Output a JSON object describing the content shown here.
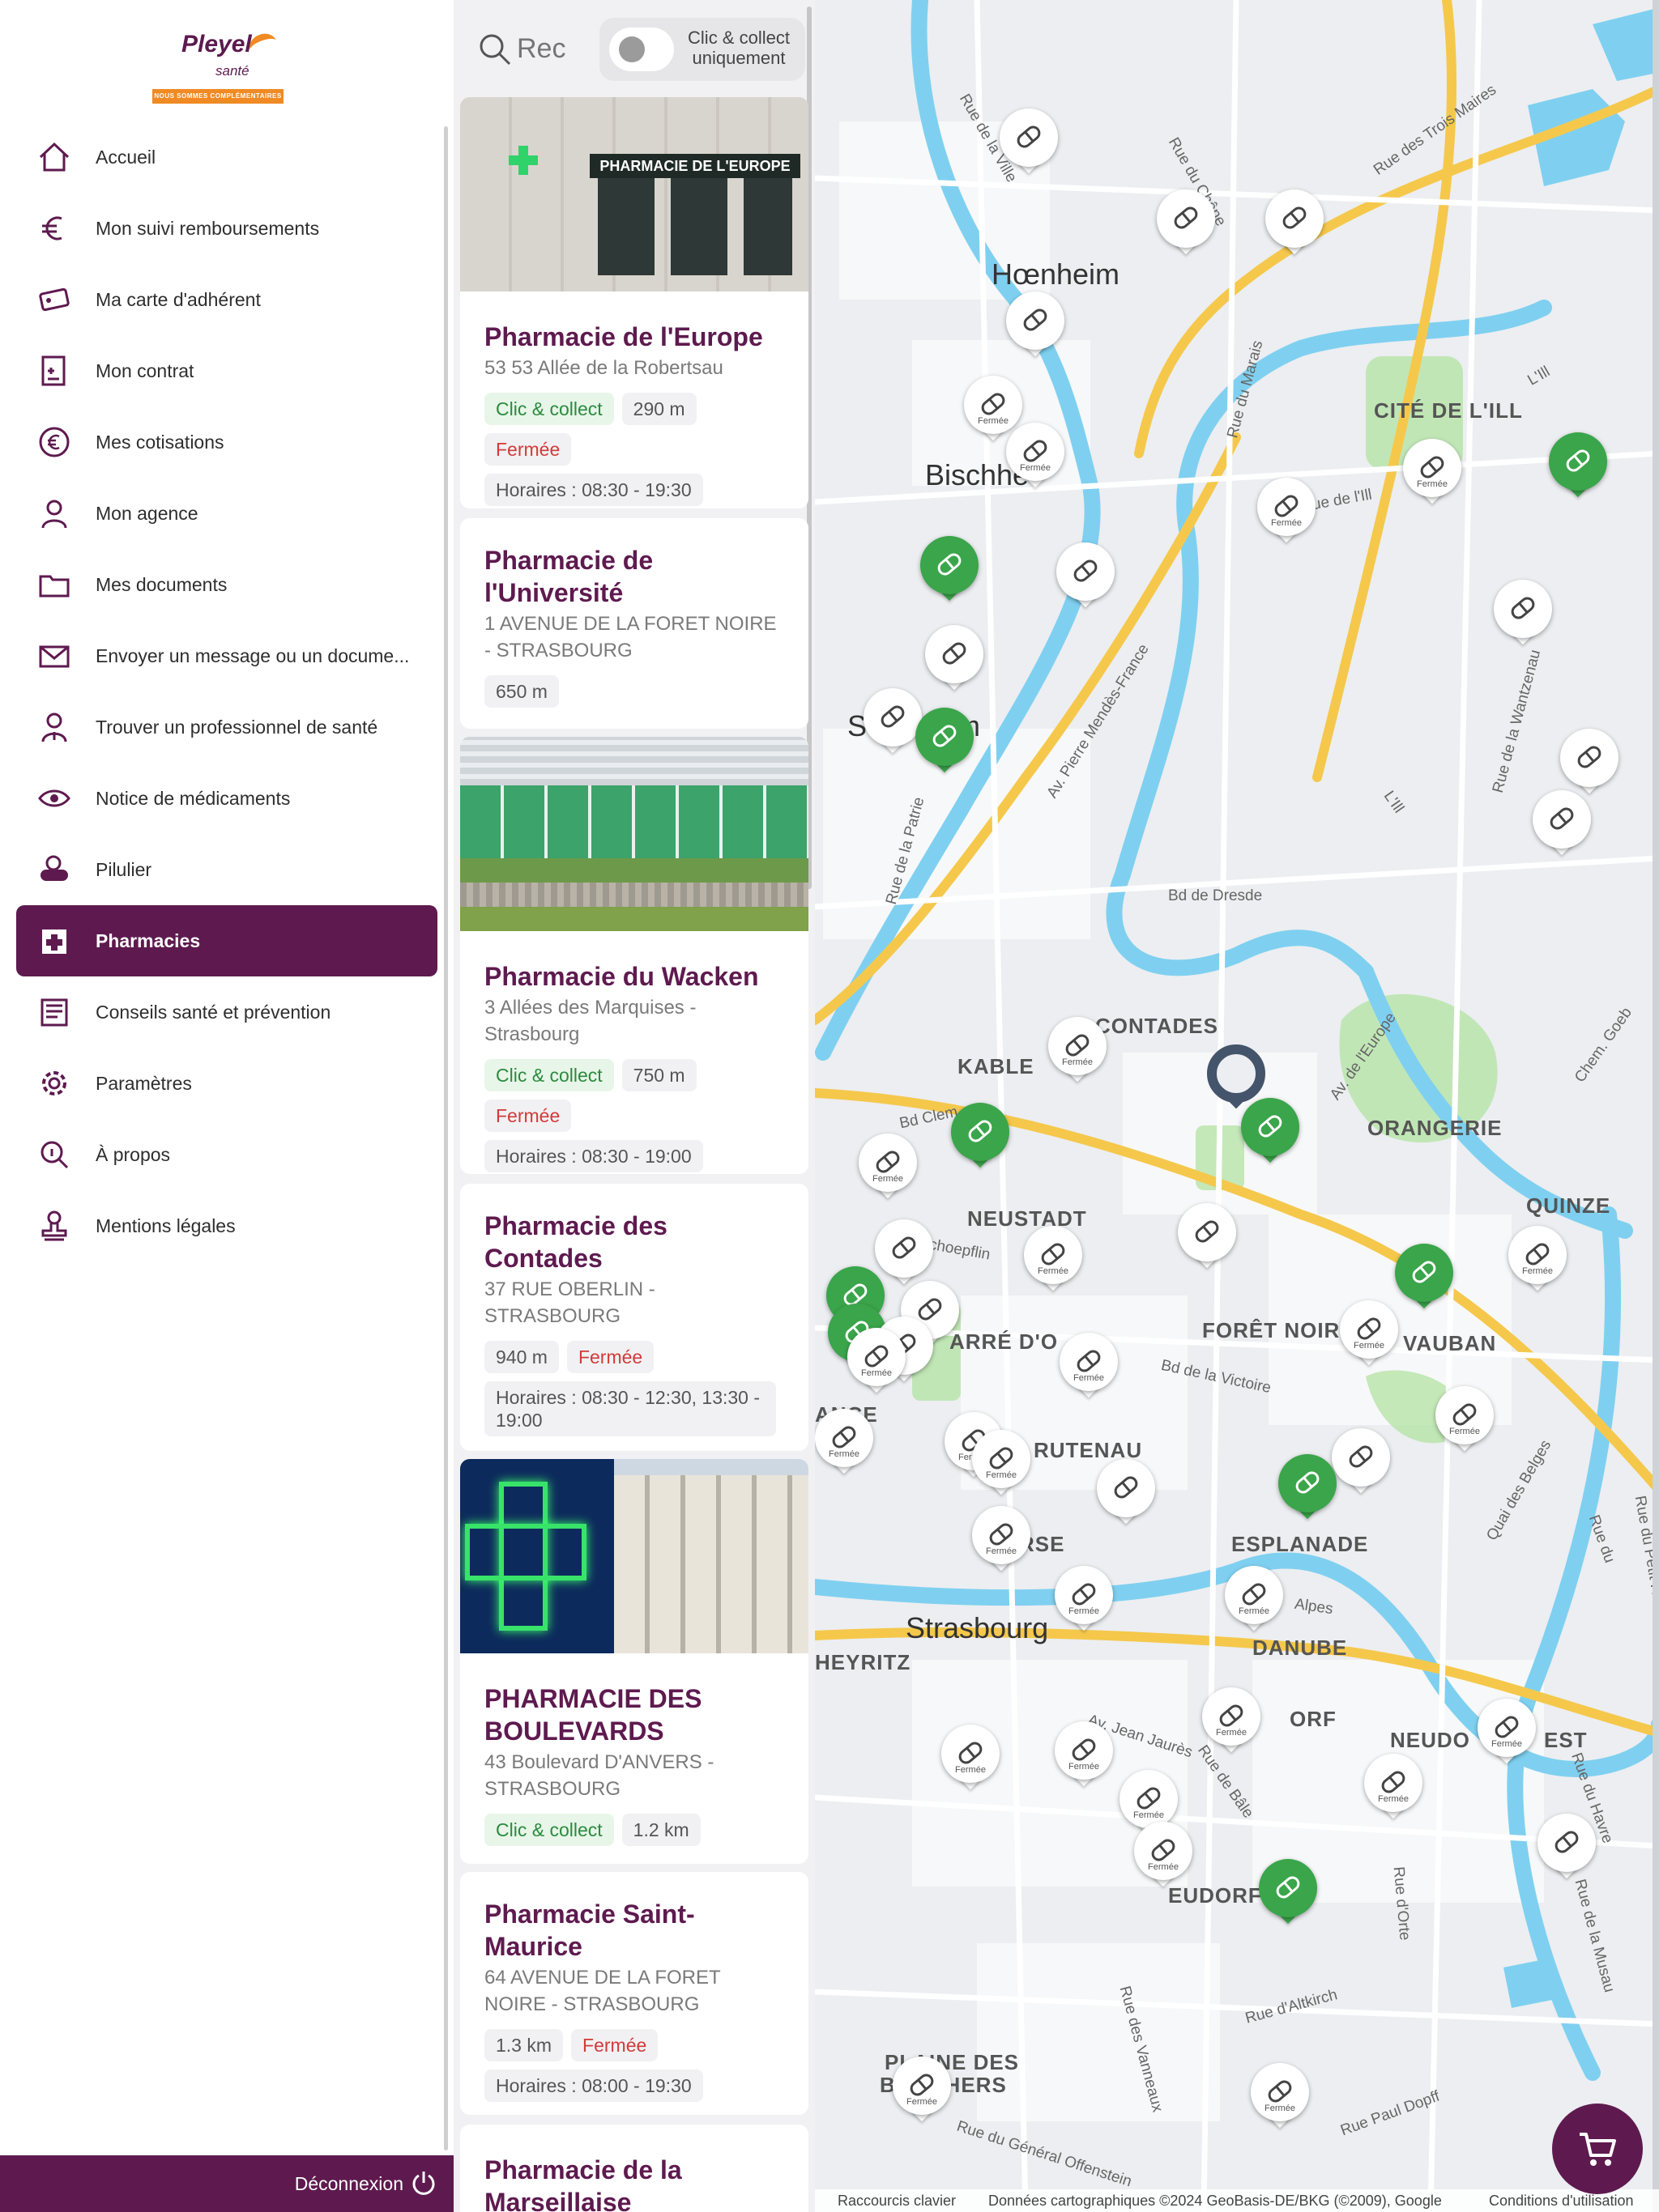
{
  "logo": {
    "brand": "Pleyel",
    "sub": "santé",
    "tagline": "NOUS SOMMES COMPLÉMENTAIRES"
  },
  "menu": [
    {
      "label": "Accueil",
      "icon": "home-icon"
    },
    {
      "label": "Mon suivi remboursements",
      "icon": "euro-icon"
    },
    {
      "label": "Ma carte d'adhérent",
      "icon": "card-icon"
    },
    {
      "label": "Mon contrat",
      "icon": "contract-icon"
    },
    {
      "label": "Mes cotisations",
      "icon": "euro-circle-icon"
    },
    {
      "label": "Mon agence",
      "icon": "agent-icon"
    },
    {
      "label": "Mes documents",
      "icon": "folder-icon"
    },
    {
      "label": "Envoyer un message ou un docume...",
      "icon": "envelope-icon"
    },
    {
      "label": "Trouver un professionnel de santé",
      "icon": "doctor-icon"
    },
    {
      "label": "Notice de médicaments",
      "icon": "eye-pill-icon"
    },
    {
      "label": "Pilulier",
      "icon": "pill-box-icon"
    },
    {
      "label": "Pharmacies",
      "icon": "pharmacy-icon",
      "active": true
    },
    {
      "label": "Conseils santé et prévention",
      "icon": "newspaper-icon"
    },
    {
      "label": "Paramètres",
      "icon": "gear-icon"
    },
    {
      "label": "À propos",
      "icon": "info-search-icon"
    },
    {
      "label": "Mentions légales",
      "icon": "stamp-icon"
    }
  ],
  "logout": {
    "label": "Déconnexion"
  },
  "search": {
    "placeholder": "Rechercher",
    "value": ""
  },
  "toggle": {
    "label": "Clic & collect uniquement",
    "on": false
  },
  "pharmacies": [
    {
      "name": "Pharmacie de l'Europe",
      "address": "53 53 Allée de la Robertsau",
      "clic_collect": "Clic & collect",
      "distance": "290 m",
      "status": "Fermée",
      "hours": "Horaires : 08:30 - 19:30",
      "photo_sign": "PHARMACIE DE L'EUROPE"
    },
    {
      "name": "Pharmacie de l'Université",
      "address": "1 AVENUE DE LA FORET NOIRE - STRASBOURG",
      "distance": "650 m"
    },
    {
      "name": "Pharmacie du Wacken",
      "address": "3 Allées des Marquises - Strasbourg",
      "clic_collect": "Clic & collect",
      "distance": "750 m",
      "status": "Fermée",
      "hours": "Horaires : 08:30 - 19:00"
    },
    {
      "name": "Pharmacie des Contades",
      "address": "37 RUE OBERLIN - STRASBOURG",
      "distance": "940 m",
      "status": "Fermée",
      "hours": "Horaires : 08:30 - 12:30, 13:30 - 19:00"
    },
    {
      "name": "PHARMACIE DES BOULEVARDS",
      "address": "43 Boulevard D'ANVERS - STRASBOURG",
      "clic_collect": "Clic & collect",
      "distance": "1.2 km"
    },
    {
      "name": "Pharmacie Saint-Maurice",
      "address": "64 AVENUE DE LA FORET NOIRE - STRASBOURG",
      "distance": "1.3 km",
      "status": "Fermée",
      "hours": "Horaires : 08:00 - 19:30"
    },
    {
      "name": "Pharmacie de la Marseillaise"
    }
  ],
  "map": {
    "pin_closed_label": "Fermée",
    "colors": {
      "open_pin": "#3aa54a",
      "closed_pin": "#ffffff",
      "river": "#7fd0f0",
      "highway": "#f5c84c",
      "park": "#b7e3a8"
    },
    "areas": [
      "Hœnheim",
      "Bischhe",
      "CITÉ DE L'ILL",
      "S",
      "m",
      "CONTADES",
      "KABLE",
      "ORANGERIE",
      "NEUSTADT",
      "QUINZE",
      "FORÊT NOIR",
      "VAUBAN",
      "ARRÉ D'O",
      "ANCE",
      "RUTENAU",
      "ESPLANADE",
      "RSE",
      "Strasbourg",
      "HEYRITZ",
      "DANUBE",
      "N",
      "ORF",
      "NEUDO",
      "EST",
      "EUDORF",
      "PLAINE DES",
      "BOUCHERS"
    ],
    "streets": [
      "Rue de la Ville",
      "Rue du Chêne",
      "Rue des Trois Maires",
      "Rue du Marais",
      "Rue de l'Ill",
      "Av. Pierre Mendès-France",
      "Bd de Dresde",
      "Rue de la Patrie",
      "Rue de la Wantzenau",
      "Av. de l'Europe",
      "Bd Clem",
      "Schoepflin",
      "Bd de la Victoire",
      "Rue du",
      "Quai des Belges",
      "Alpes",
      "Av. Jean Jaurès",
      "Rue de Bâle",
      "Rue d'Altkirch",
      "Rue d'Orte",
      "Rue du Général Offenstein",
      "Rue Paul Dopff",
      "Rue du Havre",
      "Rue du Petit Rhin",
      "Chem. Goeb",
      "L'Ill",
      "L'Ill",
      "Rue de la Musau",
      "Rue des Vanneaux"
    ],
    "attribution": {
      "shortcuts": "Raccourcis clavier",
      "data": "Données cartographiques ©2024 GeoBasis-DE/BKG (©2009), Google",
      "terms": "Conditions d'utilisation"
    }
  },
  "cart": {
    "icon": "cart-icon"
  }
}
